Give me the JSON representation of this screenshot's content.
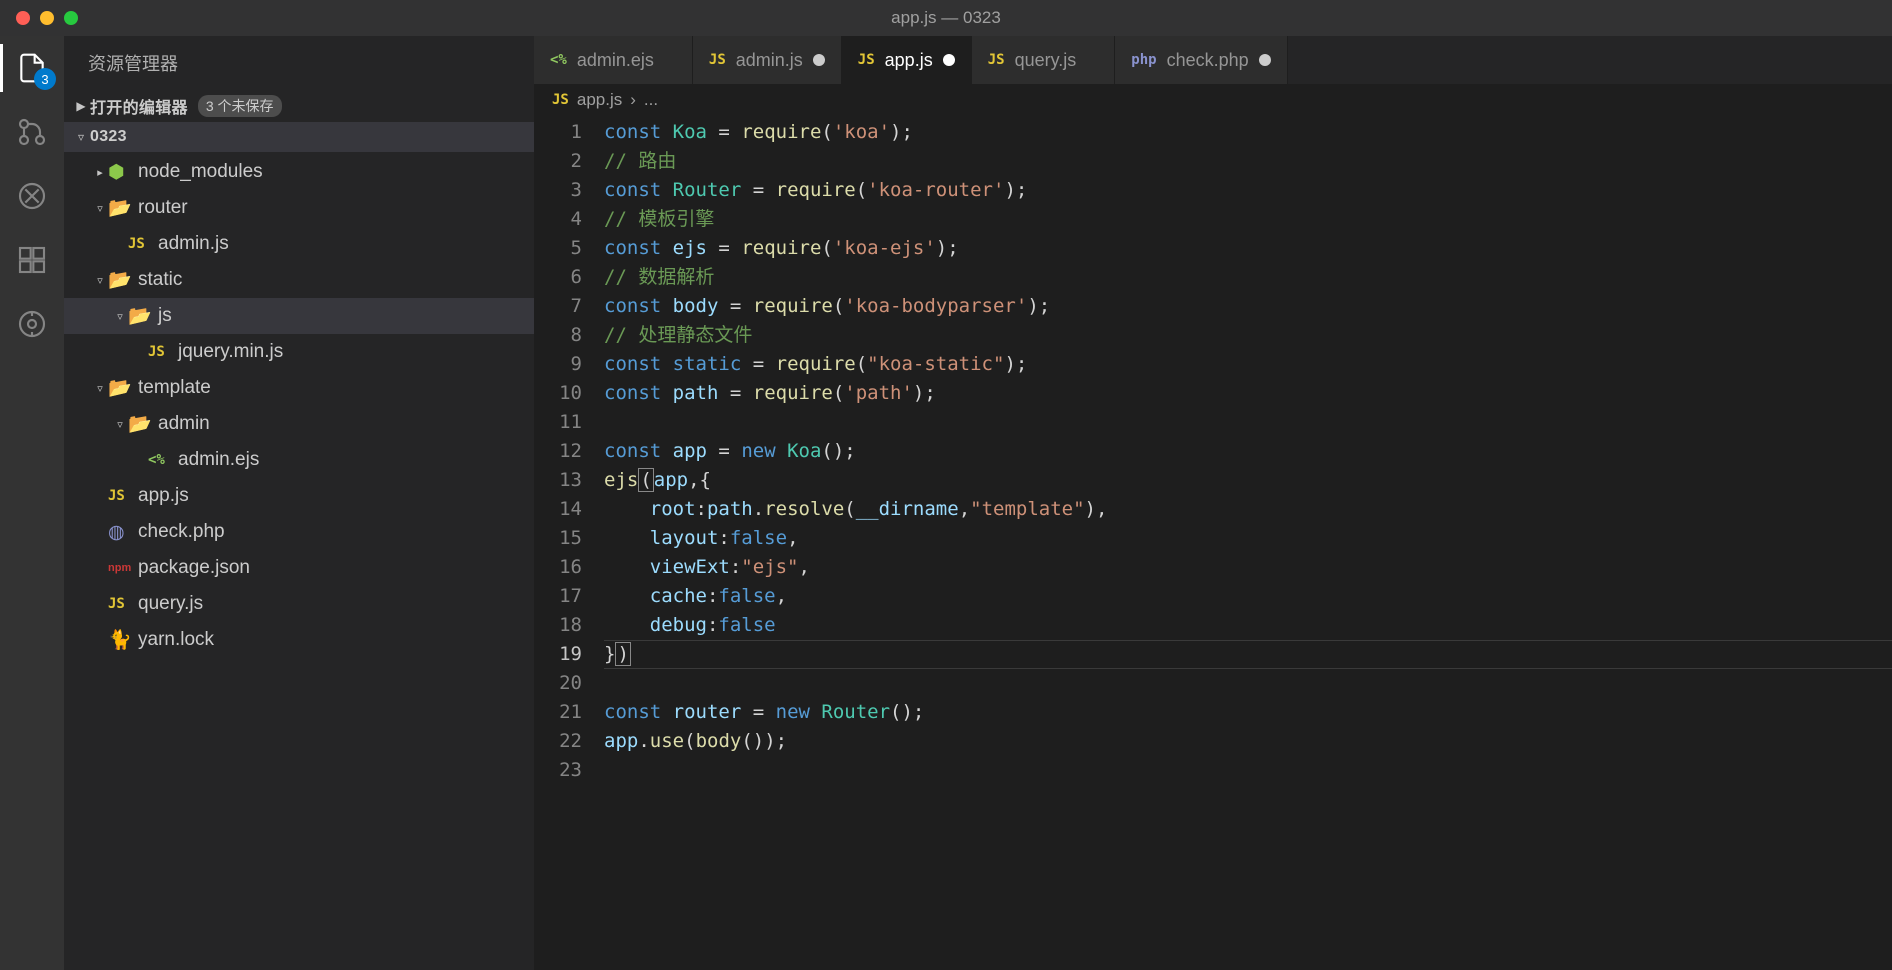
{
  "title": "app.js — 0323",
  "sidebar": {
    "title": "资源管理器",
    "openEditors": {
      "label": "打开的编辑器",
      "unsaved": "3 个未保存"
    },
    "project": "0323"
  },
  "activity": {
    "explorerBadge": "3"
  },
  "tree": [
    {
      "name": "node_modules",
      "kind": "folder-node",
      "indent": 1,
      "expandable": true,
      "expanded": false
    },
    {
      "name": "router",
      "kind": "folder-open",
      "indent": 1,
      "expandable": true,
      "expanded": true
    },
    {
      "name": "admin.js",
      "kind": "js",
      "indent": 2
    },
    {
      "name": "static",
      "kind": "folder-open",
      "indent": 1,
      "expandable": true,
      "expanded": true
    },
    {
      "name": "js",
      "kind": "folder-open-alt",
      "indent": 2,
      "expandable": true,
      "expanded": true,
      "selected": true
    },
    {
      "name": "jquery.min.js",
      "kind": "js",
      "indent": 3
    },
    {
      "name": "template",
      "kind": "folder-open-alt",
      "indent": 1,
      "expandable": true,
      "expanded": true
    },
    {
      "name": "admin",
      "kind": "folder-open",
      "indent": 2,
      "expandable": true,
      "expanded": true
    },
    {
      "name": "admin.ejs",
      "kind": "ejs",
      "indent": 3
    },
    {
      "name": "app.js",
      "kind": "js",
      "indent": 1
    },
    {
      "name": "check.php",
      "kind": "php",
      "indent": 1
    },
    {
      "name": "package.json",
      "kind": "npm",
      "indent": 1
    },
    {
      "name": "query.js",
      "kind": "js",
      "indent": 1
    },
    {
      "name": "yarn.lock",
      "kind": "yarn",
      "indent": 1
    }
  ],
  "tabs": [
    {
      "icon": "<%",
      "iconClass": "ico-ejs",
      "label": "admin.ejs",
      "dirty": false,
      "active": false
    },
    {
      "icon": "JS",
      "iconClass": "ico-js",
      "label": "admin.js",
      "dirty": true,
      "active": false
    },
    {
      "icon": "JS",
      "iconClass": "ico-js",
      "label": "app.js",
      "dirty": true,
      "active": true
    },
    {
      "icon": "JS",
      "iconClass": "ico-js",
      "label": "query.js",
      "dirty": false,
      "active": false
    },
    {
      "icon": "php",
      "iconClass": "ico-php",
      "label": "check.php",
      "dirty": true,
      "active": false
    }
  ],
  "breadcrumb": {
    "icon": "JS",
    "file": "app.js",
    "sep": "›",
    "rest": "..."
  },
  "code": {
    "currentLine": 19,
    "lines": [
      [
        [
          "kw",
          "const"
        ],
        [
          "punct",
          " "
        ],
        [
          "type",
          "Koa"
        ],
        [
          "punct",
          " = "
        ],
        [
          "fn",
          "require"
        ],
        [
          "punct",
          "("
        ],
        [
          "str",
          "'koa'"
        ],
        [
          "punct",
          ");"
        ]
      ],
      [
        [
          "comment",
          "// 路由"
        ]
      ],
      [
        [
          "kw",
          "const"
        ],
        [
          "punct",
          " "
        ],
        [
          "type",
          "Router"
        ],
        [
          "punct",
          " = "
        ],
        [
          "fn",
          "require"
        ],
        [
          "punct",
          "("
        ],
        [
          "str",
          "'koa-router'"
        ],
        [
          "punct",
          ");"
        ]
      ],
      [
        [
          "comment",
          "// 模板引擎"
        ]
      ],
      [
        [
          "kw",
          "const"
        ],
        [
          "punct",
          " "
        ],
        [
          "var",
          "ejs"
        ],
        [
          "punct",
          " = "
        ],
        [
          "fn",
          "require"
        ],
        [
          "punct",
          "("
        ],
        [
          "str",
          "'koa-ejs'"
        ],
        [
          "punct",
          ");"
        ]
      ],
      [
        [
          "comment",
          "// 数据解析"
        ]
      ],
      [
        [
          "kw",
          "const"
        ],
        [
          "punct",
          " "
        ],
        [
          "var",
          "body"
        ],
        [
          "punct",
          " = "
        ],
        [
          "fn",
          "require"
        ],
        [
          "punct",
          "("
        ],
        [
          "str",
          "'koa-bodyparser'"
        ],
        [
          "punct",
          ");"
        ]
      ],
      [
        [
          "comment",
          "// 处理静态文件"
        ]
      ],
      [
        [
          "kw",
          "const"
        ],
        [
          "punct",
          " "
        ],
        [
          "kw",
          "static"
        ],
        [
          "punct",
          " = "
        ],
        [
          "fn",
          "require"
        ],
        [
          "punct",
          "("
        ],
        [
          "str",
          "\"koa-static\""
        ],
        [
          "punct",
          ");"
        ]
      ],
      [
        [
          "kw",
          "const"
        ],
        [
          "punct",
          " "
        ],
        [
          "var",
          "path"
        ],
        [
          "punct",
          " = "
        ],
        [
          "fn",
          "require"
        ],
        [
          "punct",
          "("
        ],
        [
          "str",
          "'path'"
        ],
        [
          "punct",
          ");"
        ]
      ],
      [],
      [
        [
          "kw",
          "const"
        ],
        [
          "punct",
          " "
        ],
        [
          "var",
          "app"
        ],
        [
          "punct",
          " = "
        ],
        [
          "kw",
          "new"
        ],
        [
          "punct",
          " "
        ],
        [
          "type",
          "Koa"
        ],
        [
          "punct",
          "();"
        ]
      ],
      [
        [
          "fn",
          "ejs"
        ],
        [
          "punct-box",
          "("
        ],
        [
          "var",
          "app"
        ],
        [
          "punct",
          ",{"
        ]
      ],
      [
        [
          "punct",
          "    "
        ],
        [
          "prop",
          "root"
        ],
        [
          "punct",
          ":"
        ],
        [
          "var",
          "path"
        ],
        [
          "punct",
          "."
        ],
        [
          "fn",
          "resolve"
        ],
        [
          "punct",
          "("
        ],
        [
          "var",
          "__dirname"
        ],
        [
          "punct",
          ","
        ],
        [
          "str",
          "\"template\""
        ],
        [
          "punct",
          "),"
        ]
      ],
      [
        [
          "punct",
          "    "
        ],
        [
          "prop",
          "layout"
        ],
        [
          "punct",
          ":"
        ],
        [
          "bool",
          "false"
        ],
        [
          "punct",
          ","
        ]
      ],
      [
        [
          "punct",
          "    "
        ],
        [
          "prop",
          "viewExt"
        ],
        [
          "punct",
          ":"
        ],
        [
          "str",
          "\"ejs\""
        ],
        [
          "punct",
          ","
        ]
      ],
      [
        [
          "punct",
          "    "
        ],
        [
          "prop",
          "cache"
        ],
        [
          "punct",
          ":"
        ],
        [
          "bool",
          "false"
        ],
        [
          "punct",
          ","
        ]
      ],
      [
        [
          "punct",
          "    "
        ],
        [
          "prop",
          "debug"
        ],
        [
          "punct",
          ":"
        ],
        [
          "bool",
          "false"
        ]
      ],
      [
        [
          "punct",
          "}"
        ],
        [
          "punct-box",
          ")"
        ]
      ],
      [],
      [
        [
          "kw",
          "const"
        ],
        [
          "punct",
          " "
        ],
        [
          "var",
          "router"
        ],
        [
          "punct",
          " = "
        ],
        [
          "kw",
          "new"
        ],
        [
          "punct",
          " "
        ],
        [
          "type",
          "Router"
        ],
        [
          "punct",
          "();"
        ]
      ],
      [
        [
          "var",
          "app"
        ],
        [
          "punct",
          "."
        ],
        [
          "fn",
          "use"
        ],
        [
          "punct",
          "("
        ],
        [
          "fn",
          "body"
        ],
        [
          "punct",
          "());"
        ]
      ],
      []
    ]
  }
}
